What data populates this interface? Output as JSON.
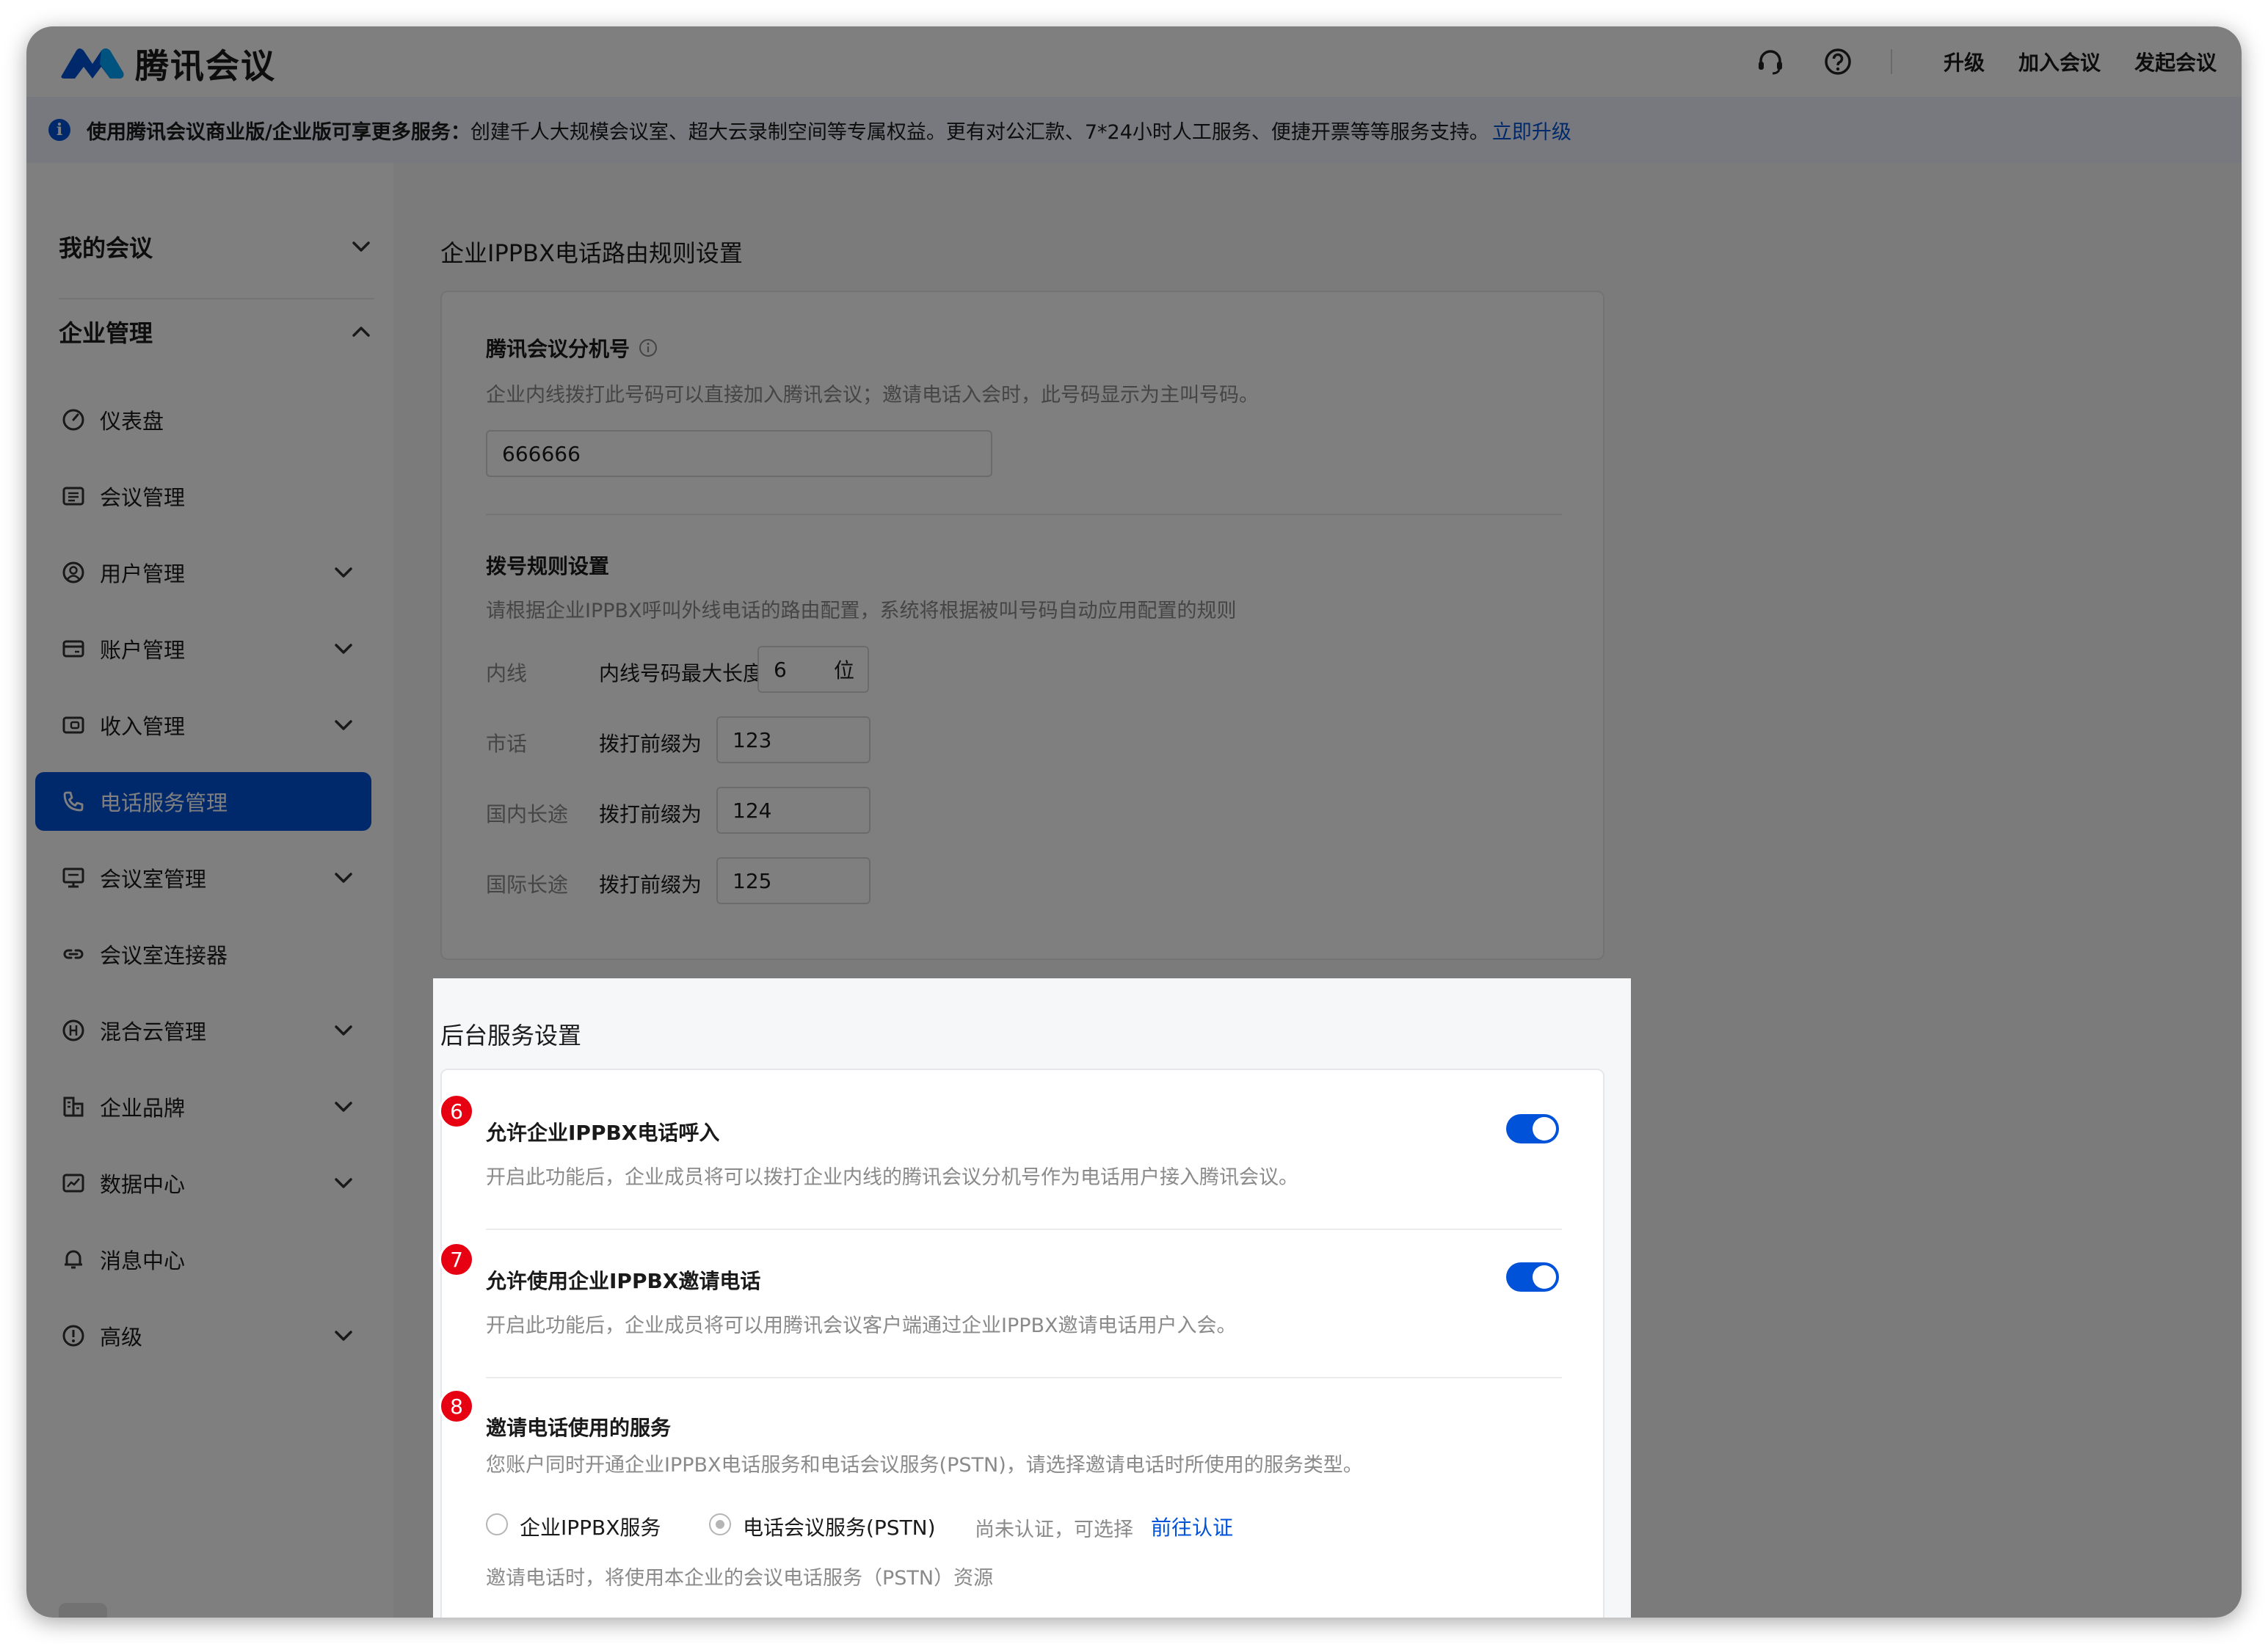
{
  "app": {
    "logo_text": "腾讯会议",
    "nav_links": [
      "升级",
      "加入会议",
      "发起会议"
    ],
    "icons": {
      "support": "headset-icon",
      "help": "question-icon"
    },
    "colors": {
      "brand": "#0052d9",
      "badge": "#e60012"
    }
  },
  "banner": {
    "bold_text": "使用腾讯会议商业版/企业版可享更多服务：",
    "text": "创建千人大规模会议室、超大云录制空间等专属权益。更有对公汇款、7*24小时人工服务、便捷开票等等服务支持。",
    "link": "立即升级"
  },
  "sidebar": {
    "my_meetings": "我的会议",
    "enterprise": "企业管理",
    "items": [
      {
        "label": "仪表盘",
        "icon": "gauge-icon",
        "has_children": false
      },
      {
        "label": "会议管理",
        "icon": "list-icon",
        "has_children": false
      },
      {
        "label": "用户管理",
        "icon": "user-icon",
        "has_children": true
      },
      {
        "label": "账户管理",
        "icon": "wallet-icon",
        "has_children": true
      },
      {
        "label": "收入管理",
        "icon": "income-icon",
        "has_children": true
      },
      {
        "label": "电话服务管理",
        "icon": "phone-icon",
        "has_children": false,
        "active": true
      },
      {
        "label": "会议室管理",
        "icon": "monitor-icon",
        "has_children": true
      },
      {
        "label": "会议室连接器",
        "icon": "link-icon",
        "has_children": false
      },
      {
        "label": "混合云管理",
        "icon": "hybrid-cloud-icon",
        "has_children": true
      },
      {
        "label": "企业品牌",
        "icon": "brand-icon",
        "has_children": true
      },
      {
        "label": "数据中心",
        "icon": "chart-icon",
        "has_children": true
      },
      {
        "label": "消息中心",
        "icon": "bell-icon",
        "has_children": false
      },
      {
        "label": "高级",
        "icon": "advanced-icon",
        "has_children": true
      }
    ]
  },
  "routing": {
    "section_title": "企业IPPBX电话路由规则设置",
    "ext_title": "腾讯会议分机号",
    "ext_desc": "企业内线拨打此号码可以直接加入腾讯会议；邀请电话入会时，此号码显示为主叫号码。",
    "ext_value": "666666",
    "dial_title": "拨号规则设置",
    "dial_desc": "请根据企业IPPBX呼叫外线电话的路由配置，系统将根据被叫号码自动应用配置的规则",
    "rows": [
      {
        "label": "内线",
        "sub": "内线号码最大长度为",
        "value": "6",
        "suffix": "位"
      },
      {
        "label": "市话",
        "sub": "拨打前缀为",
        "value": "123"
      },
      {
        "label": "国内长途",
        "sub": "拨打前缀为",
        "value": "124"
      },
      {
        "label": "国际长途",
        "sub": "拨打前缀为",
        "value": "125"
      }
    ]
  },
  "backend": {
    "section_title": "后台服务设置",
    "settings": [
      {
        "badge": "6",
        "title": "允许企业IPPBX电话呼入",
        "desc": "开启此功能后，企业成员将可以拨打企业内线的腾讯会议分机号作为电话用户接入腾讯会议。",
        "enabled": true
      },
      {
        "badge": "7",
        "title": "允许使用企业IPPBX邀请电话",
        "desc": "开启此功能后，企业成员将可以用腾讯会议客户端通过企业IPPBX邀请电话用户入会。",
        "enabled": true
      }
    ],
    "service": {
      "badge": "8",
      "title": "邀请电话使用的服务",
      "desc": "您账户同时开通企业IPPBX电话服务和电话会议服务(PSTN)，请选择邀请电话时所使用的服务类型。",
      "option1": "企业IPPBX服务",
      "option2": "电话会议服务(PSTN)",
      "option2_note": "尚未认证，可选择",
      "option2_link": "前往认证",
      "footer": "邀请电话时，将使用本企业的会议电话服务（PSTN）资源"
    }
  }
}
